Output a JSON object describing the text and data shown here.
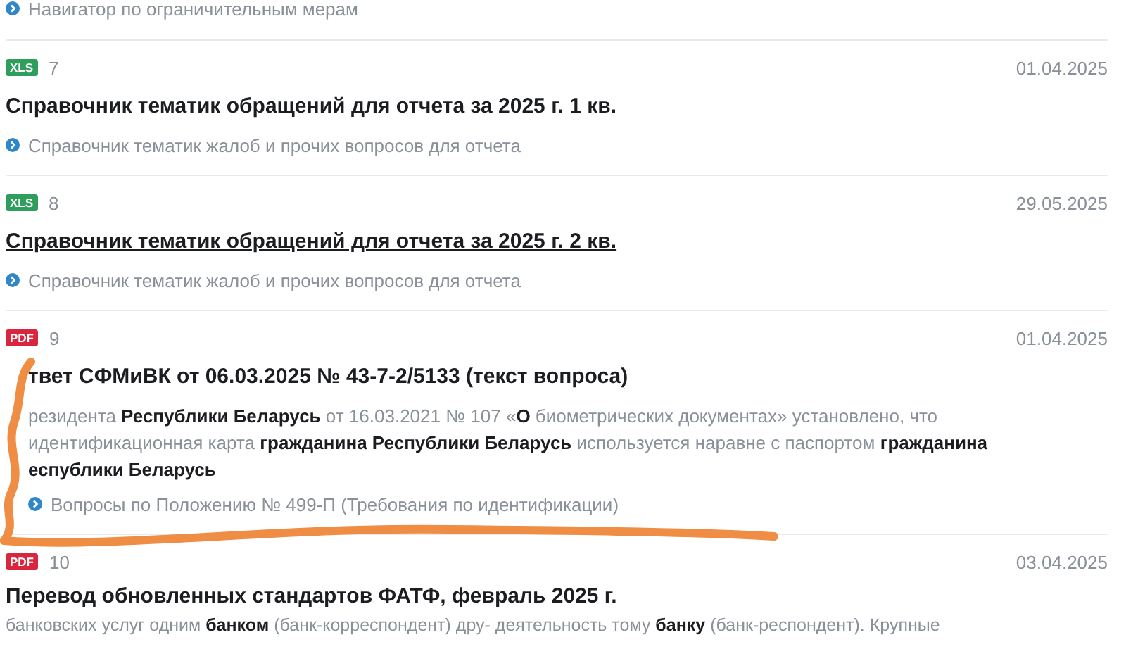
{
  "top_tag": "Навигатор по ограничительным мерам",
  "documents": [
    {
      "kind": "xls",
      "badge": "XLS",
      "number": "7",
      "date": "01.04.2025",
      "title": "Справочник тематик обращений для отчета за 2025 г. 1 кв.",
      "hovered": false,
      "tag": "Справочник тематик жалоб и прочих вопросов для отчета"
    },
    {
      "kind": "xls",
      "badge": "XLS",
      "number": "8",
      "date": "29.05.2025",
      "title": "Справочник тематик обращений для отчета за 2025 г. 2 кв.",
      "hovered": true,
      "tag": "Справочник тематик жалоб и прочих вопросов для отчета"
    },
    {
      "kind": "pdf",
      "badge": "PDF",
      "number": "9",
      "date": "01.04.2025",
      "title": "твет СФМиВК от 06.03.2025 № 43-7-2/5133 (текст вопроса)",
      "hovered": false,
      "snippet": "резидента **Республики Беларусь** от 16.03.2021 № 107 «**О** биометрических документах» установлено, что идентификационная карта **гражданина Республики Беларусь** используется наравне с паспортом **гражданина** **еспублики Беларусь**",
      "tag": "Вопросы по Положению № 499-П (Требования по идентификации)"
    },
    {
      "kind": "pdf",
      "badge": "PDF",
      "number": "10",
      "date": "03.04.2025",
      "title": "Перевод обновленных стандартов ФАТФ, февраль 2025 г.",
      "hovered": false,
      "snippet": "банковских услуг одним **банком** (банк-корреспондент) дру- деятельность тому **банку** (банк-респондент). Крупные"
    }
  ],
  "annotation": {
    "kind": "scribble"
  }
}
